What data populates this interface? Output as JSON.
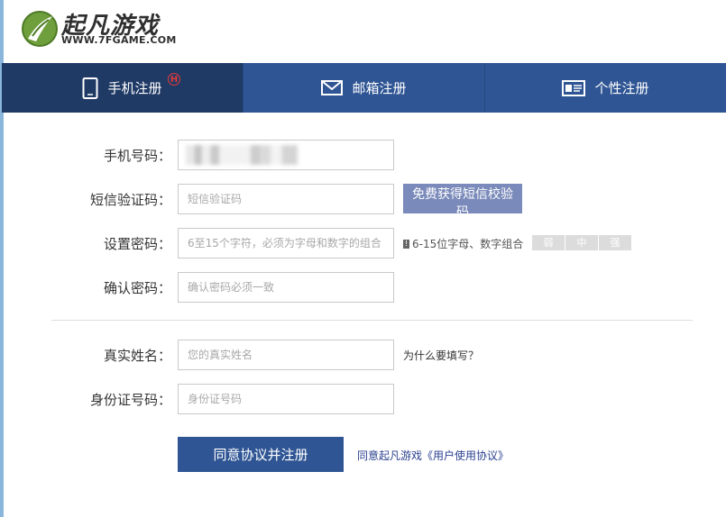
{
  "logo": {
    "name": "起凡游戏",
    "url_text": "WWW.7FGAME.COM"
  },
  "tabs": [
    {
      "label": "手机注册",
      "icon": "phone-icon",
      "active": true,
      "badge": "H"
    },
    {
      "label": "邮箱注册",
      "icon": "envelope-icon",
      "active": false
    },
    {
      "label": "个性注册",
      "icon": "id-card-icon",
      "active": false
    }
  ],
  "form": {
    "phone": {
      "label": "手机号码：",
      "value": ""
    },
    "sms": {
      "label": "短信验证码：",
      "placeholder": "短信验证码",
      "button": "免费获得短信校验码"
    },
    "password": {
      "label": "设置密码：",
      "placeholder": "6至15个字符，必须为字母和数字的组合",
      "hint": "6-15位字母、数字组合",
      "hint_icon": "!",
      "strength": [
        "弱",
        "中",
        "强"
      ]
    },
    "confirm": {
      "label": "确认密码：",
      "placeholder": "确认密码必须一致"
    },
    "realname": {
      "label": "真实姓名：",
      "placeholder": "您的真实姓名",
      "why_link": "为什么要填写？"
    },
    "idcard": {
      "label": "身份证号码：",
      "placeholder": "身份证号码"
    }
  },
  "submit_label": "同意协议并注册",
  "agreement_link": "同意起凡游戏《用户使用协议》",
  "colors": {
    "tab_bg": "#2f5594",
    "tab_active_bg": "#203a66",
    "sms_button": "#7a8aba",
    "submit": "#2f5594",
    "badge": "#e23b3b"
  }
}
